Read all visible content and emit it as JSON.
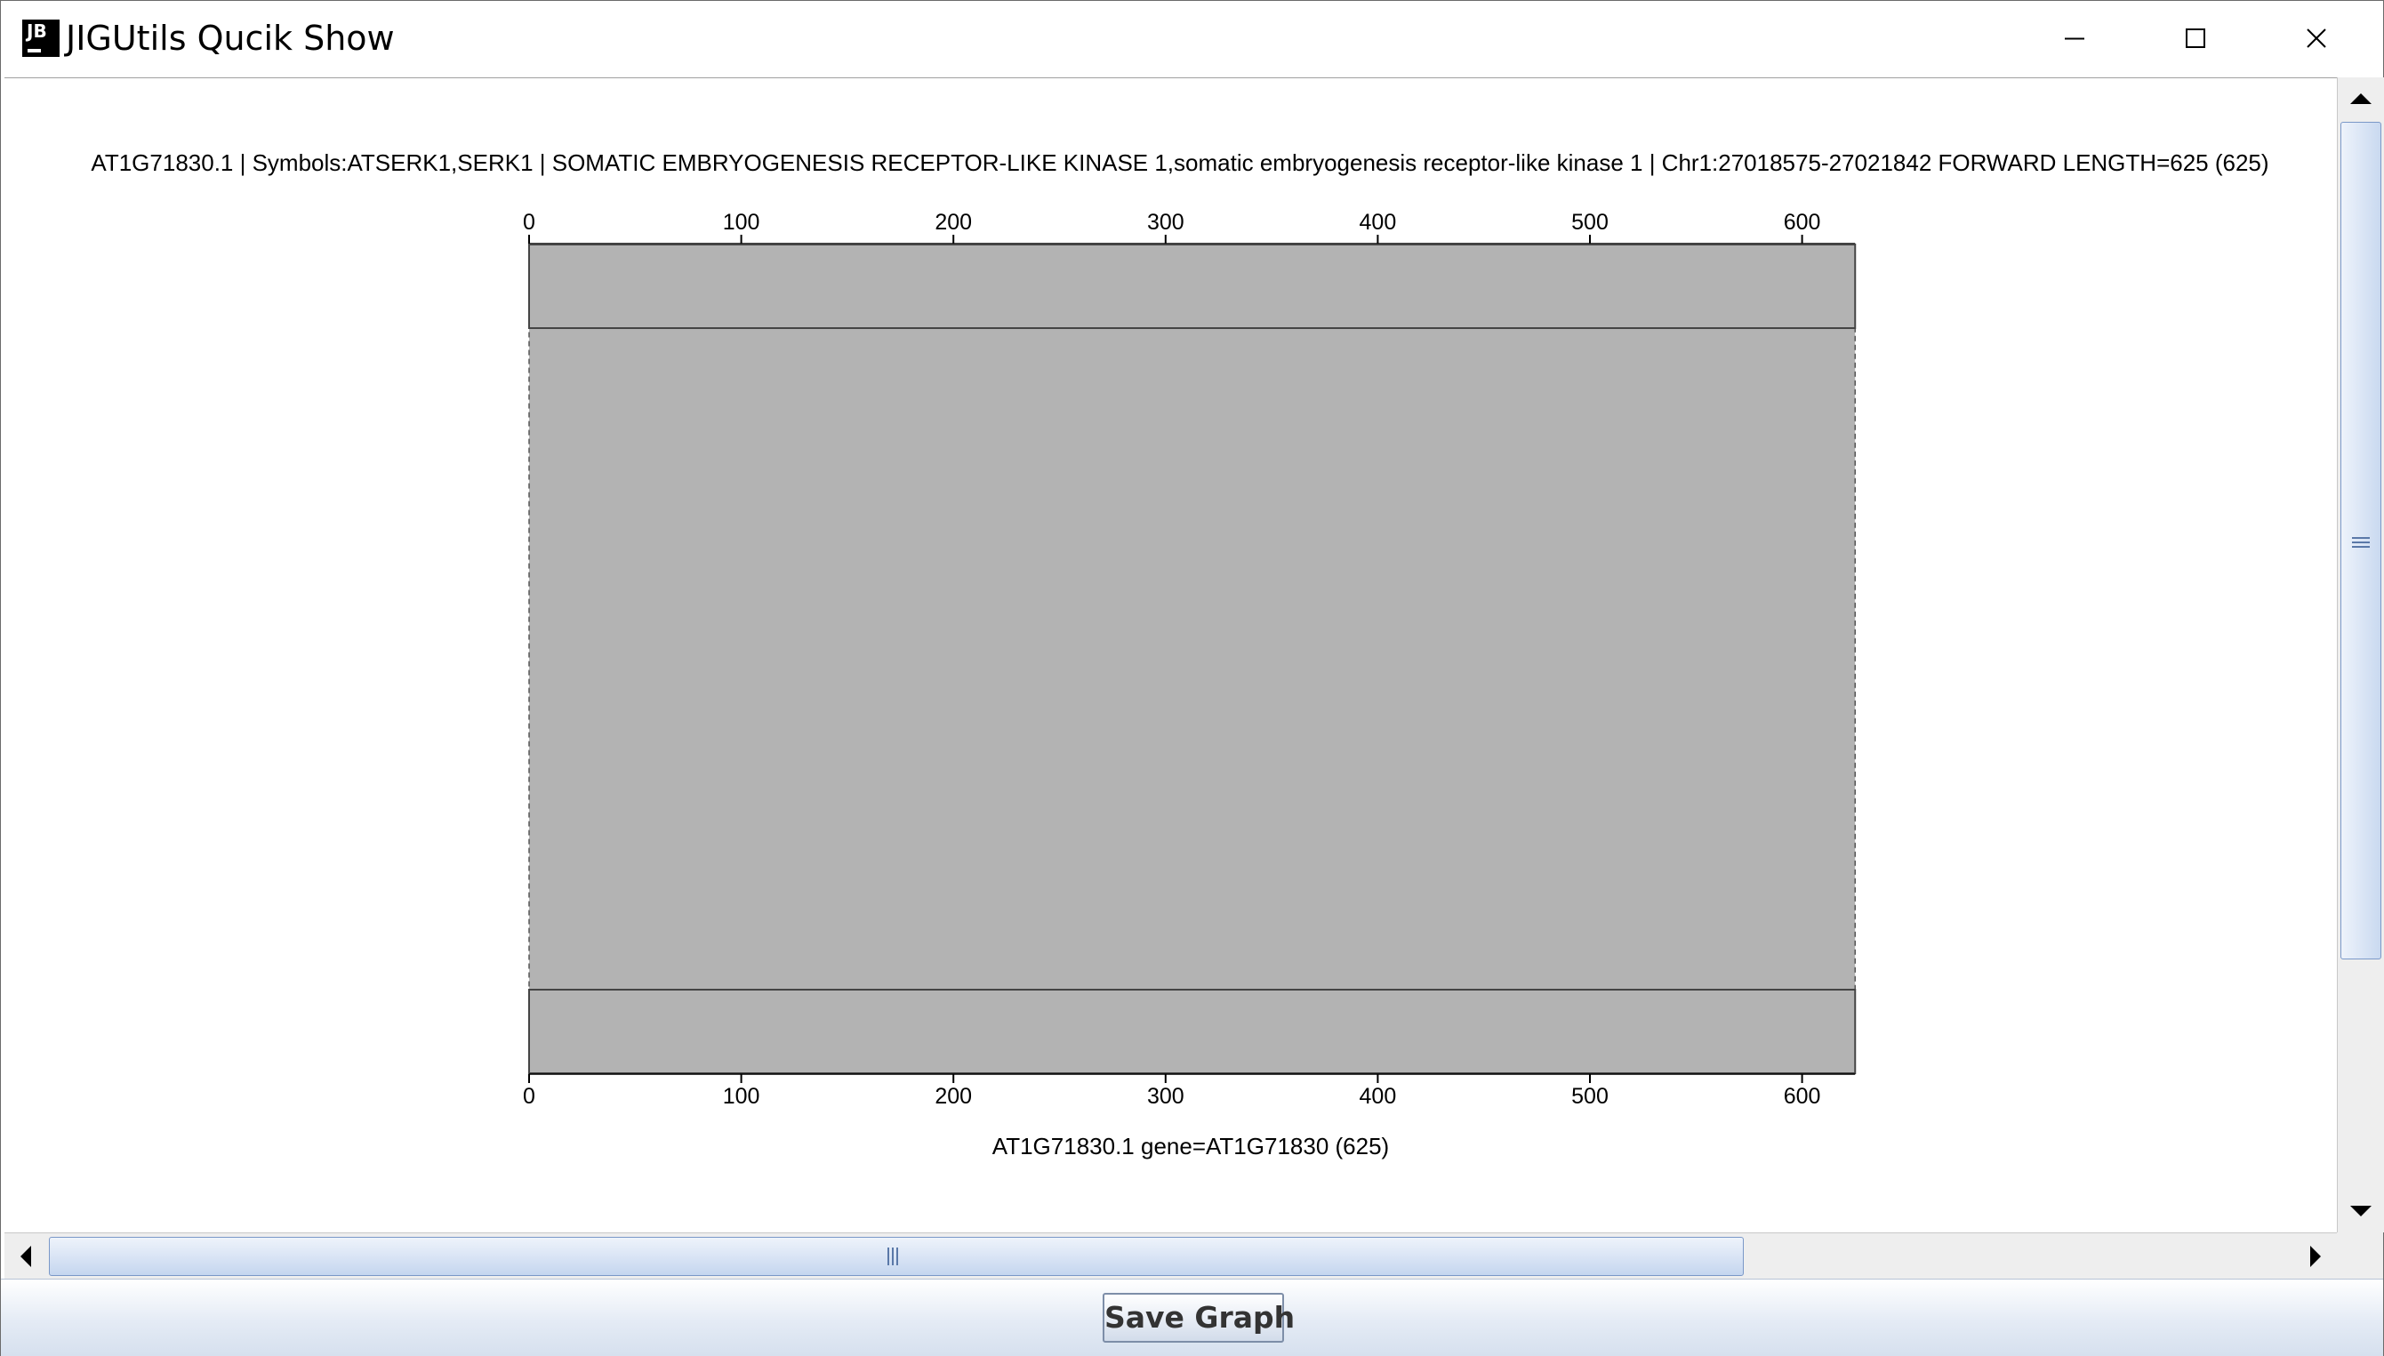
{
  "window": {
    "title": "JIGUtils Qucik Show",
    "app_icon_text": "JB",
    "controls": [
      "minimize",
      "maximize",
      "close"
    ]
  },
  "graph": {
    "header": "AT1G71830.1 | Symbols:ATSERK1,SERK1 | SOMATIC EMBRYOGENESIS RECEPTOR-LIKE KINASE 1,somatic embryogenesis receptor-like kinase 1 | Chr1:27018575-27021842 FORWARD LENGTH=625 (625)",
    "footer": "AT1G71830.1 gene=AT1G71830 (625)",
    "axis": {
      "min": 0,
      "max": 625,
      "ticks": [
        0,
        100,
        200,
        300,
        400,
        500,
        600
      ]
    },
    "top_sequence_length": 625,
    "bottom_sequence_length": 625,
    "alignment": {
      "top_start": 0,
      "top_end": 625,
      "bottom_start": 0,
      "bottom_end": 625
    },
    "colors": {
      "bar_fill": "#b3b3b3",
      "bar_stroke": "#444444",
      "alignment_fill": "#b3b3b3"
    }
  },
  "buttons": {
    "save_graph": "Save Graph"
  }
}
